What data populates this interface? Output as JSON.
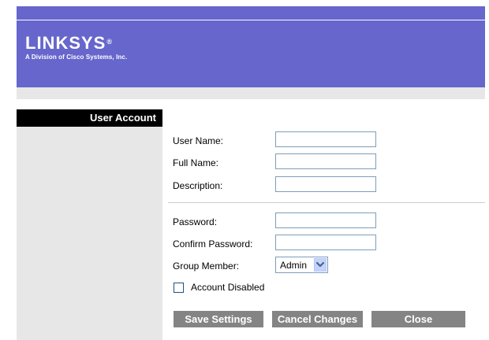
{
  "header": {
    "logo_name": "LINKSYS",
    "logo_mark": "®",
    "logo_tagline": "A Division of Cisco Systems, Inc."
  },
  "sidebar": {
    "title": "User Account"
  },
  "form": {
    "user_name_label": "User Name:",
    "user_name_value": "",
    "full_name_label": "Full Name:",
    "full_name_value": "",
    "description_label": "Description:",
    "description_value": "",
    "password_label": "Password:",
    "password_value": "",
    "confirm_password_label": "Confirm Password:",
    "confirm_password_value": "",
    "group_member_label": "Group Member:",
    "group_member_value": "Admin",
    "account_disabled_label": "Account Disabled",
    "account_disabled_checked": false
  },
  "buttons": {
    "save_label": "Save Settings",
    "cancel_label": "Cancel Changes",
    "close_label": "Close"
  },
  "colors": {
    "banner": "#6666cc",
    "panel": "#e7e7e7",
    "button": "#848484"
  }
}
